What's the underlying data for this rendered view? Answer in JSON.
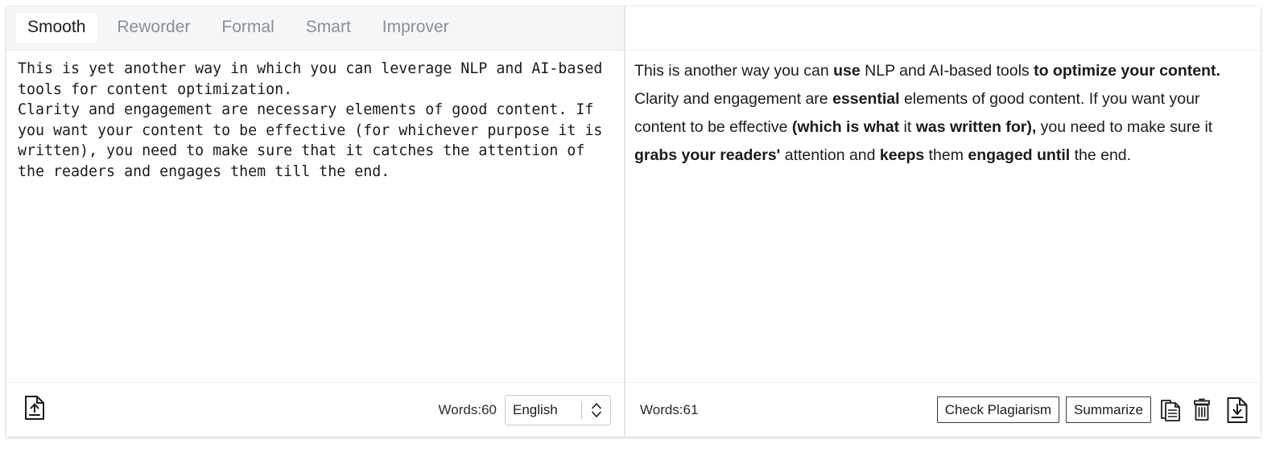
{
  "tabs": [
    {
      "id": "smooth",
      "label": "Smooth",
      "active": true
    },
    {
      "id": "reworder",
      "label": "Reworder",
      "active": false
    },
    {
      "id": "formal",
      "label": "Formal",
      "active": false
    },
    {
      "id": "smart",
      "label": "Smart",
      "active": false
    },
    {
      "id": "improver",
      "label": "Improver",
      "active": false
    }
  ],
  "left_panel": {
    "input_text": "This is yet another way in which you can leverage NLP and AI-based tools for content optimization.\nClarity and engagement are necessary elements of good content. If you want your content to be effective (for whichever purpose it is written), you need to make sure that it catches the attention of the readers and engages them till the end.",
    "footer": {
      "upload_icon": "file-upload-icon",
      "word_count": "Words:60",
      "language_value": "English",
      "language_options": [
        "English"
      ],
      "chevron_icon": "chevron-up-down-icon"
    }
  },
  "right_panel": {
    "output_segments": [
      {
        "text": "This is  another way  you can ",
        "bold": false
      },
      {
        "text": "use",
        "bold": true
      },
      {
        "text": " NLP and AI-based tools ",
        "bold": false
      },
      {
        "text": "to optimize your content.",
        "bold": true
      },
      {
        "text": "\n Clarity and engagement are ",
        "bold": false
      },
      {
        "text": "essential",
        "bold": true
      },
      {
        "text": " elements of good content. If you want your content to be effective ",
        "bold": false
      },
      {
        "text": "(which is what",
        "bold": true
      },
      {
        "text": " it ",
        "bold": false
      },
      {
        "text": "was written for),",
        "bold": true
      },
      {
        "text": " you need to make sure  it ",
        "bold": false
      },
      {
        "text": "grabs your readers'",
        "bold": true
      },
      {
        "text": " attention  and ",
        "bold": false
      },
      {
        "text": "keeps",
        "bold": true
      },
      {
        "text": " them ",
        "bold": false
      },
      {
        "text": "engaged until",
        "bold": true
      },
      {
        "text": " the end.",
        "bold": false
      }
    ],
    "footer": {
      "word_count": "Words:61",
      "check_plagiarism_label": "Check Plagiarism",
      "summarize_label": "Summarize",
      "copy_icon": "copy-icon",
      "delete_icon": "trash-icon",
      "download_icon": "file-download-icon"
    }
  },
  "colors": {
    "tab_active_text": "#1d1d1d",
    "tab_inactive_text": "#8a8f94",
    "tabbar_bg": "#f5f6f7",
    "body_text": "#1b1b1b",
    "border": "#c9c9c9"
  }
}
